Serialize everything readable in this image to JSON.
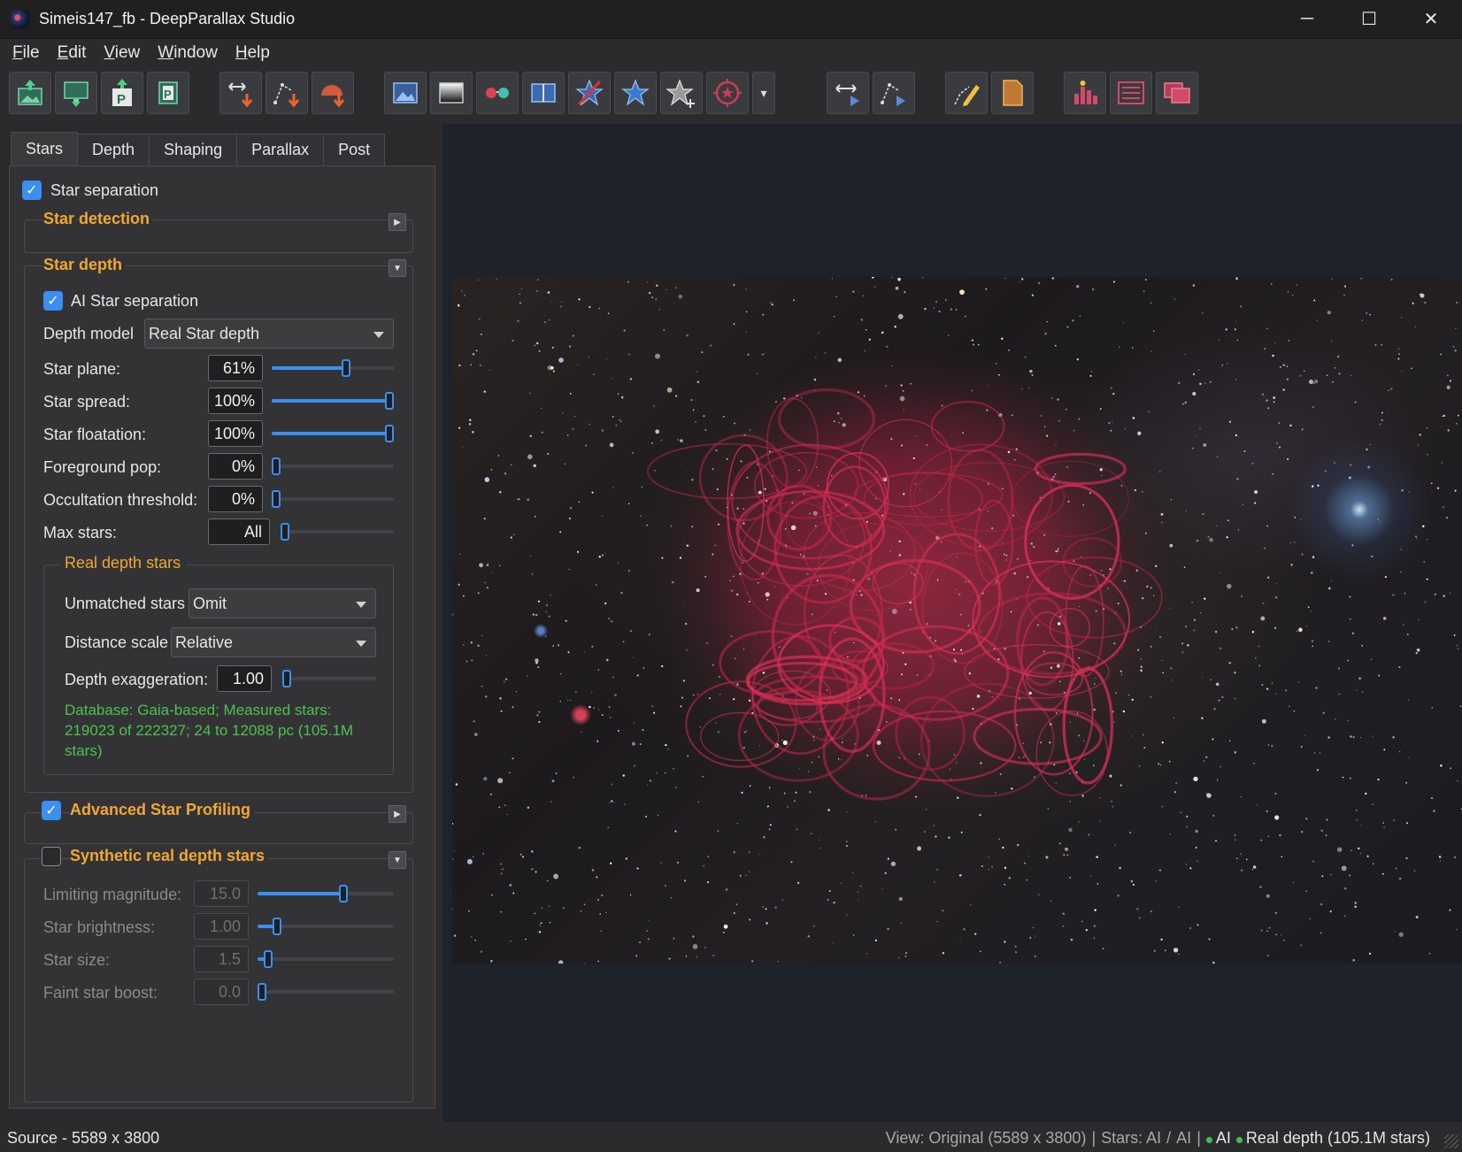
{
  "window": {
    "title": "Simeis147_fb - DeepParallax Studio",
    "controls": {
      "minimize": "─",
      "maximize": "☐",
      "close": "✕"
    }
  },
  "menu": [
    "File",
    "Edit",
    "View",
    "Window",
    "Help"
  ],
  "toolbar": {
    "buttons": [
      "open-image",
      "display",
      "open-project",
      "save-project",
      "depth-tool",
      "path-tool",
      "arc-tool",
      "view-image",
      "view-depth",
      "anaglyph",
      "side-by-side",
      "star-remove",
      "star-select",
      "star-add",
      "star-target",
      "parallax-move",
      "parallax-path",
      "annotate",
      "document",
      "histogram",
      "list",
      "export"
    ],
    "dropdown_glyph": "▾"
  },
  "tabs": [
    "Stars",
    "Depth",
    "Shaping",
    "Parallax",
    "Post"
  ],
  "stars": {
    "star_separation": {
      "label": "Star separation",
      "checked": true
    },
    "star_detection": {
      "title": "Star detection",
      "expand_glyph": "▶"
    },
    "star_depth": {
      "title": "Star depth",
      "collapse_glyph": "▼",
      "ai_star_separation": {
        "label": "AI Star separation",
        "checked": true
      },
      "depth_model": {
        "label": "Depth model",
        "value": "Real Star depth"
      },
      "sliders": [
        {
          "label": "Star plane:",
          "value": "61%",
          "level": 0.61
        },
        {
          "label": "Star spread:",
          "value": "100%",
          "level": 1.0
        },
        {
          "label": "Star floatation:",
          "value": "100%",
          "level": 1.0
        },
        {
          "label": "Foreground pop:",
          "value": "0%",
          "level": 0.0
        },
        {
          "label": "Occultation threshold:",
          "value": "0%",
          "level": 0.0
        },
        {
          "label": "Max stars:",
          "value": "All",
          "level": 0.0
        }
      ],
      "real_depth_stars": {
        "title": "Real depth stars",
        "unmatched_stars": {
          "label": "Unmatched stars",
          "value": "Omit"
        },
        "distance_scale": {
          "label": "Distance scale",
          "value": "Relative"
        },
        "depth_exaggeration": {
          "label": "Depth exaggeration:",
          "value": "1.00",
          "level": 0.0
        },
        "info_lines": [
          "Database: Gaia-based; Measured stars:",
          "219023 of 222327; 24 to 12088 pc  (105.1M",
          "stars)"
        ]
      }
    },
    "advanced_star_profiling": {
      "title": "Advanced Star Profiling",
      "checked": true,
      "expand_glyph": "▶"
    },
    "synthetic": {
      "title": "Synthetic real depth stars",
      "checked": false,
      "collapse_glyph": "▼",
      "sliders": [
        {
          "label": "Limiting magnitude:",
          "value": "15.0",
          "level": 0.63
        },
        {
          "label": "Star brightness:",
          "value": "1.00",
          "level": 0.14
        },
        {
          "label": "Star size:",
          "value": "1.5",
          "level": 0.08
        },
        {
          "label": "Faint star boost:",
          "value": "0.0",
          "level": 0.0
        }
      ]
    }
  },
  "status": {
    "source": "Source  -  5589 x 3800",
    "view": "View: Original (5589 x 3800)",
    "sep1": "|",
    "stars": "Stars: AI",
    "sep2": "/",
    "stars_ai": "AI",
    "sep3": "|",
    "ai_indicator": "AI",
    "real_depth": "Real depth (105.1M stars)"
  },
  "colors": {
    "accent": "#3a8ff0",
    "section_title": "#f0a830",
    "info_text": "#4cc24c"
  }
}
